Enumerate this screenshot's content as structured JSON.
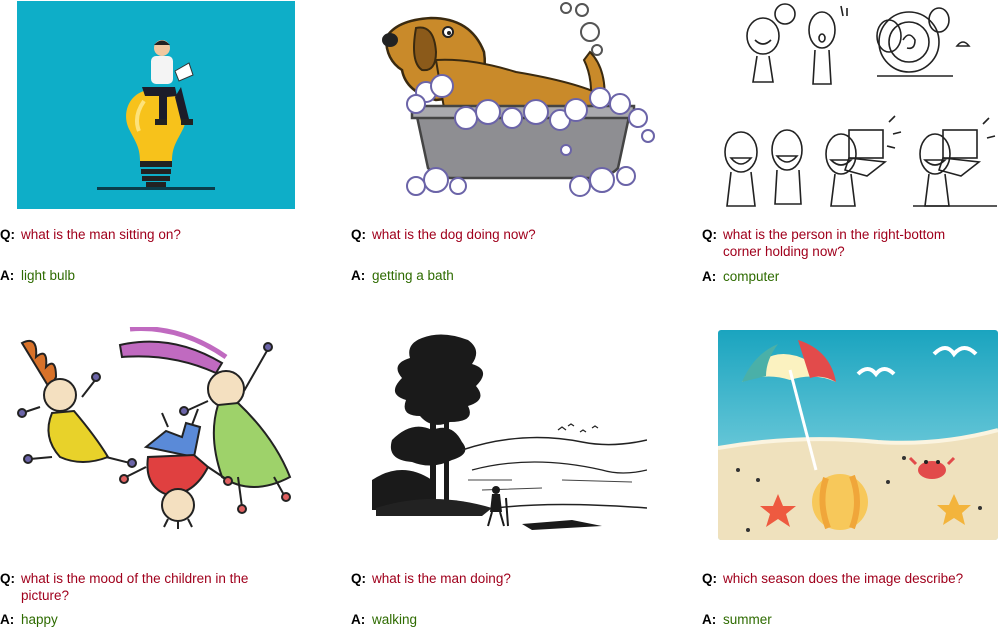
{
  "labels": {
    "q": "Q:",
    "a": "A:"
  },
  "colors": {
    "question": "#a0001c",
    "answer": "#2e6b00"
  },
  "items": [
    {
      "image": "man-reading-on-light-bulb",
      "question": "what is the man sitting on?",
      "answer": "light bulb"
    },
    {
      "image": "dog-in-bathtub",
      "question": "what is the dog doing now?",
      "answer": "getting a bath"
    },
    {
      "image": "cartoon-people-with-computers",
      "question": "what is the person in the right-bottom corner holding now?",
      "answer": "computer"
    },
    {
      "image": "children-playing",
      "question": "what is the mood of the children in the picture?",
      "answer": "happy"
    },
    {
      "image": "man-walking-landscape",
      "question": "what is the man doing?",
      "answer": "walking"
    },
    {
      "image": "beach-scene",
      "question": "which season does the image describe?",
      "answer": "summer"
    }
  ]
}
